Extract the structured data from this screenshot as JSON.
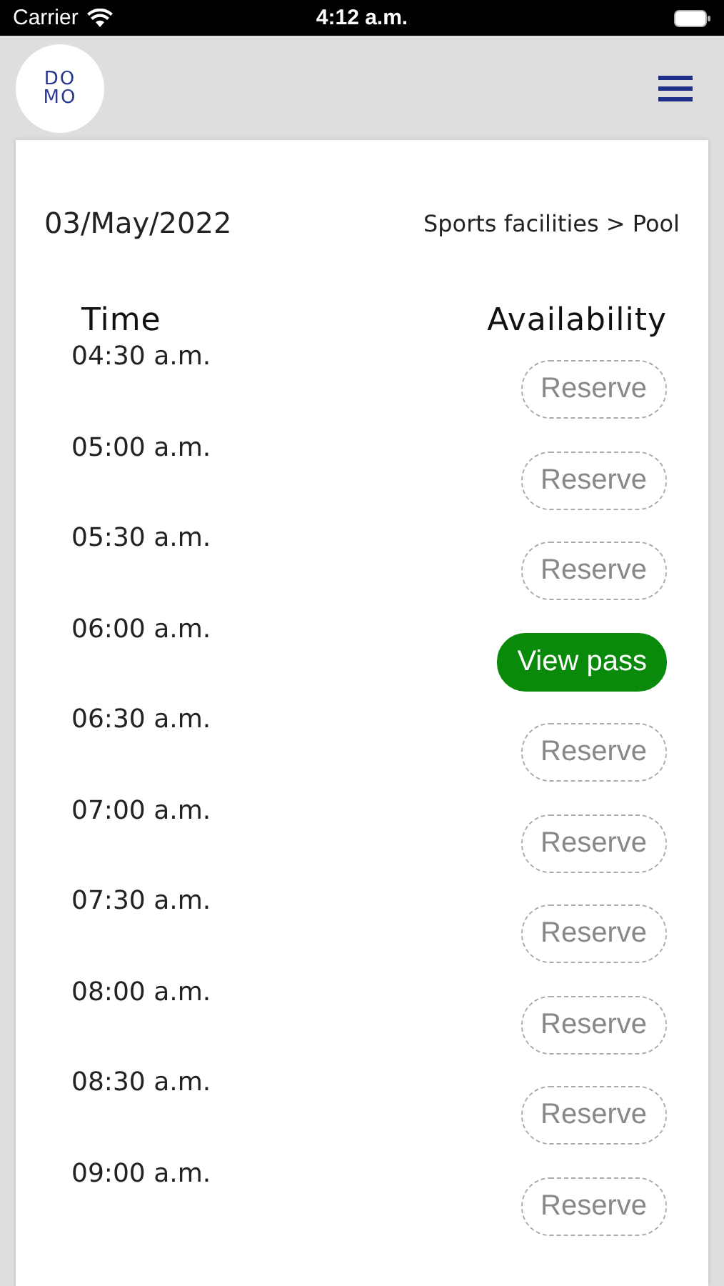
{
  "status_bar": {
    "carrier": "Carrier",
    "time": "4:12 a.m."
  },
  "header": {
    "logo_lines": [
      "DO",
      "MO"
    ]
  },
  "date": "03/May/2022",
  "breadcrumb": "Sports facilities > Pool",
  "columns": [
    "Time",
    "Availability"
  ],
  "slots": [
    {
      "time": "04:30 a.m.",
      "kind": "reserve",
      "action": "Reserve"
    },
    {
      "time": "05:00 a.m.",
      "kind": "reserve",
      "action": "Reserve"
    },
    {
      "time": "05:30 a.m.",
      "kind": "reserve",
      "action": "Reserve"
    },
    {
      "time": "06:00 a.m.",
      "kind": "pass",
      "action": "View pass"
    },
    {
      "time": "06:30 a.m.",
      "kind": "reserve",
      "action": "Reserve"
    },
    {
      "time": "07:00 a.m.",
      "kind": "reserve",
      "action": "Reserve"
    },
    {
      "time": "07:30 a.m.",
      "kind": "reserve",
      "action": "Reserve"
    },
    {
      "time": "08:00 a.m.",
      "kind": "reserve",
      "action": "Reserve"
    },
    {
      "time": "08:30 a.m.",
      "kind": "reserve",
      "action": "Reserve"
    },
    {
      "time": "09:00 a.m.",
      "kind": "reserve",
      "action": "Reserve"
    }
  ]
}
